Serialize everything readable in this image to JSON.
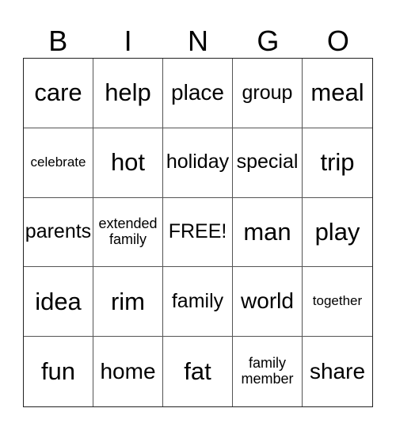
{
  "header": [
    "B",
    "I",
    "N",
    "G",
    "O"
  ],
  "cells": [
    {
      "text": "care",
      "size": "l"
    },
    {
      "text": "help",
      "size": "l"
    },
    {
      "text": "place",
      "size": "m"
    },
    {
      "text": "group",
      "size": "ms"
    },
    {
      "text": "meal",
      "size": "l"
    },
    {
      "text": "celebrate",
      "size": "xs"
    },
    {
      "text": "hot",
      "size": "l"
    },
    {
      "text": "holiday",
      "size": "ms"
    },
    {
      "text": "special",
      "size": "ms"
    },
    {
      "text": "trip",
      "size": "l"
    },
    {
      "text": "parents",
      "size": "ms"
    },
    {
      "text": "extended family",
      "size": "s"
    },
    {
      "text": "FREE!",
      "size": "ms"
    },
    {
      "text": "man",
      "size": "l"
    },
    {
      "text": "play",
      "size": "l"
    },
    {
      "text": "idea",
      "size": "l"
    },
    {
      "text": "rim",
      "size": "l"
    },
    {
      "text": "family",
      "size": "ms"
    },
    {
      "text": "world",
      "size": "m"
    },
    {
      "text": "together",
      "size": "xs"
    },
    {
      "text": "fun",
      "size": "l"
    },
    {
      "text": "home",
      "size": "m"
    },
    {
      "text": "fat",
      "size": "l"
    },
    {
      "text": "family member",
      "size": "s"
    },
    {
      "text": "share",
      "size": "m"
    }
  ]
}
